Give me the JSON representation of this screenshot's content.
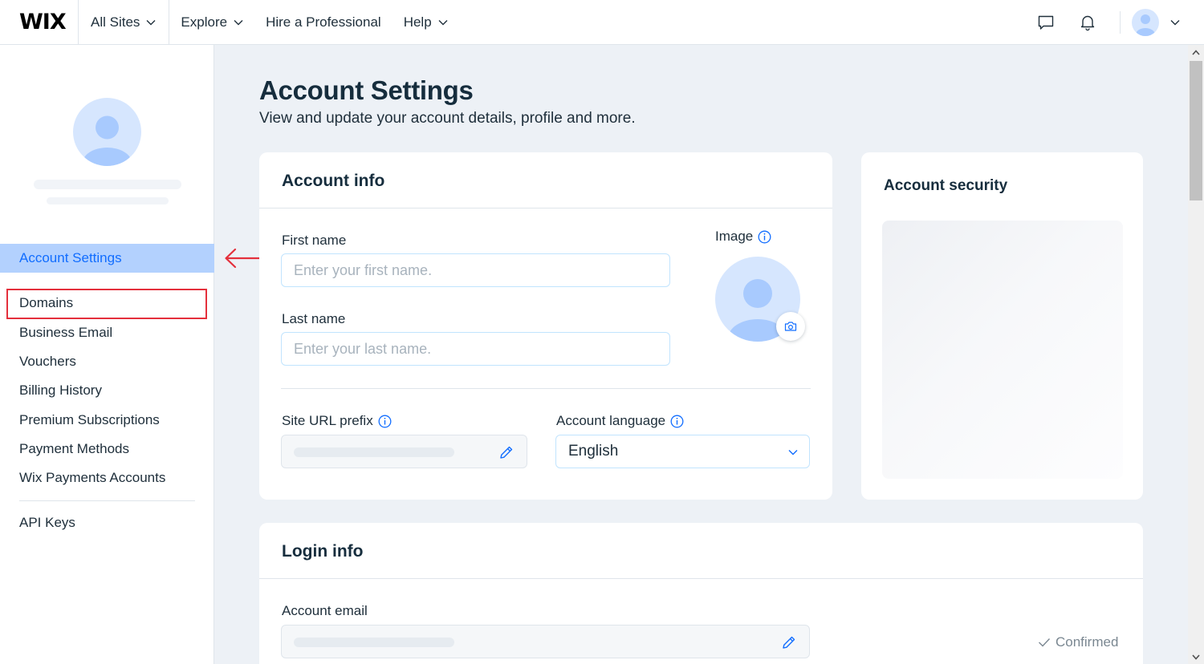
{
  "topbar": {
    "logo": "WIX",
    "nav": [
      {
        "label": "All Sites"
      },
      {
        "label": "Explore"
      },
      {
        "label": "Hire a Professional"
      },
      {
        "label": "Help"
      }
    ],
    "icons": [
      "chat-icon",
      "bell-icon",
      "avatar",
      "chevron-down-icon"
    ]
  },
  "sidebar": {
    "items": [
      {
        "label": "Account Settings",
        "active": true
      },
      {
        "label": "Domains"
      },
      {
        "label": "Business Email"
      },
      {
        "label": "Vouchers"
      },
      {
        "label": "Billing History"
      },
      {
        "label": "Premium Subscriptions"
      },
      {
        "label": "Payment Methods"
      },
      {
        "label": "Wix Payments Accounts"
      },
      {
        "label": "API Keys"
      }
    ]
  },
  "main": {
    "title": "Account Settings",
    "subtitle": "View and update your account details, profile and more."
  },
  "account_info": {
    "title": "Account info",
    "first_name_label": "First name",
    "first_name_placeholder": "Enter your first name.",
    "first_name_value": "",
    "last_name_label": "Last name",
    "last_name_placeholder": "Enter your last name.",
    "last_name_value": "",
    "image_label": "Image",
    "site_url_label": "Site URL prefix",
    "language_label": "Account language",
    "language_value": "English"
  },
  "account_security": {
    "title": "Account security"
  },
  "login_info": {
    "title": "Login info",
    "email_label": "Account email",
    "email_status": "Confirmed"
  },
  "colors": {
    "accent": "#116dff",
    "active_bg": "#b3d1fe",
    "highlight": "#e4303c",
    "page_bg": "#edf1f6"
  }
}
